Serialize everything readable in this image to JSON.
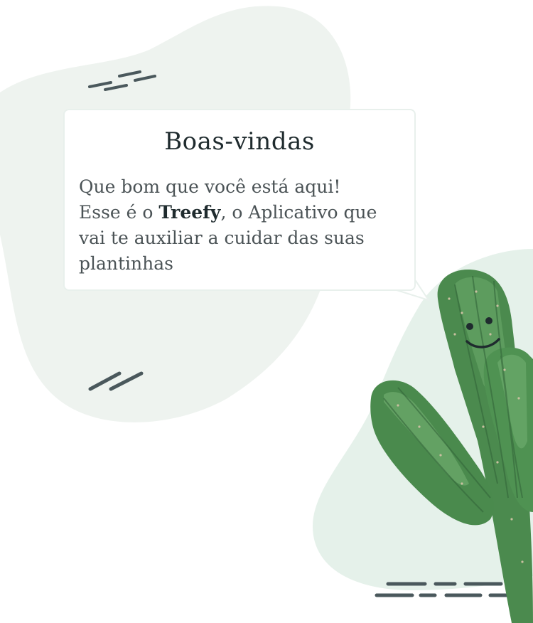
{
  "welcome": {
    "title": "Boas-vindas",
    "line1": "Que bom que você está aqui!",
    "line2_prefix": "Esse é o ",
    "app_name": "Treefy",
    "line2_suffix": ", o Aplicativo que",
    "line3": "vai te auxiliar a cuidar das suas",
    "line4": "plantinhas"
  },
  "illustration": {
    "mascot": "cactus-mascot",
    "decorations": [
      "dash-lines-top",
      "dash-lines-middle",
      "dash-lines-bottom"
    ]
  },
  "colors": {
    "blob": "#eef3ef",
    "blob_right": "#e5f1ea",
    "dash": "#4a585c",
    "cactus_dark": "#3f7a45",
    "cactus_light": "#6fae6e"
  }
}
